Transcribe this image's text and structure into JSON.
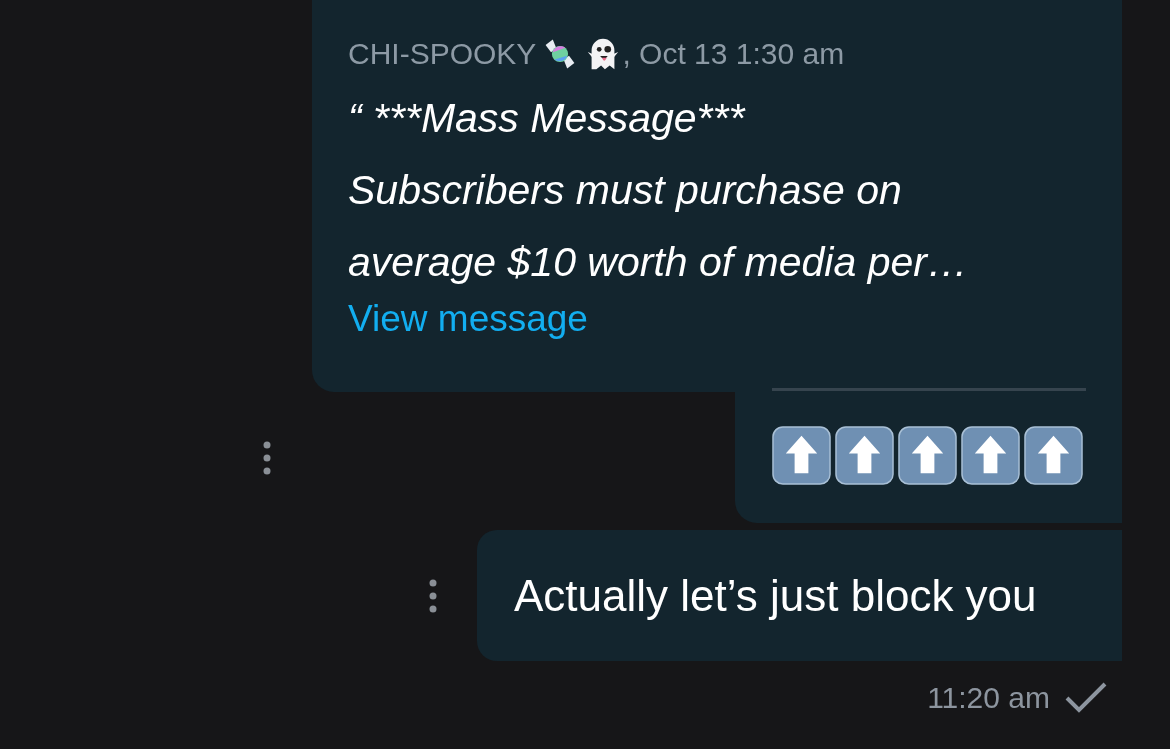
{
  "messages": [
    {
      "kind": "quote",
      "sender": "CHI-SPOOKY",
      "date": ", Oct 13 1:30 am",
      "lines": [
        "“ ***Mass Message***",
        "Subscribers must purchase on",
        "average $10 worth of media per…"
      ],
      "link": "View message"
    },
    {
      "kind": "text",
      "text": "Actually let’s just block you"
    }
  ],
  "footer": {
    "time": "11:20 am",
    "sent": true
  }
}
